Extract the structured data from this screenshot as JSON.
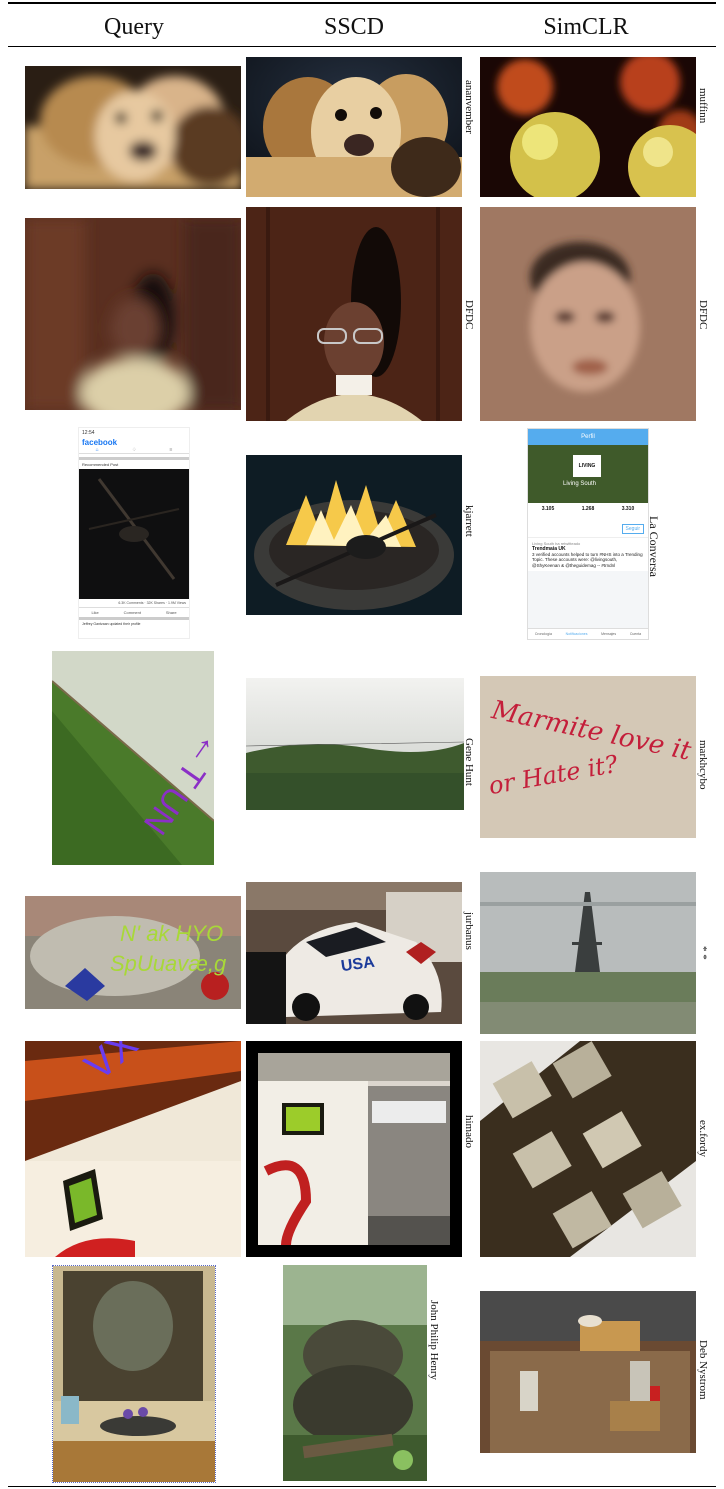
{
  "headers": [
    "Query",
    "SSCD",
    "SimCLR"
  ],
  "rows": [
    {
      "query": "blurred dog",
      "sscd_credit": "ananvember",
      "simclr_credit": "muffinn"
    },
    {
      "query": "blurred person",
      "sscd_credit": "DFDC",
      "simclr_credit": "DFDC"
    },
    {
      "query": "facebook screenshot",
      "sscd_credit": "kjarrett",
      "simclr_credit": "La Conversa"
    },
    {
      "query": "rotated meadow with text",
      "sscd_credit": "Gene Hunt",
      "simclr_credit": "markhcybo"
    },
    {
      "query": "car with overlay text",
      "sscd_credit": "jurbanus",
      "simclr_credit": "* *"
    },
    {
      "query": "train with text",
      "sscd_credit": "himado",
      "simclr_credit": "ex.fordy"
    },
    {
      "query": "window stone art",
      "sscd_credit": "John Philip Henry",
      "simclr_credit": "Deb Nystrom"
    }
  ],
  "fb": {
    "time": "12:54",
    "brand": "facebook",
    "section": "Recommended Post",
    "stats": "6.3K Comments · 32K Shares · 1.9M Views",
    "like": "Like",
    "comment": "Comment",
    "share": "Share",
    "footer": "Jeffrey Gantzaan updated their profile"
  },
  "tw": {
    "title": "Perfil",
    "banner": "LIVING",
    "name": "Living South",
    "tweets_num": "3.105",
    "following_num": "1.268",
    "followers_num": "3.310",
    "follow_btn": "Seguir",
    "tweet_head": "Living South ha retwitteado",
    "tweet_user": "Trendmaia UK",
    "tweet_text": "3 verified accounts helped to turn #NHS into a Trending Topic. These accounts were: @livingsouth, @ShyKeenan & @theguidemag -- #trndnl",
    "tabs": [
      "Cronología",
      "Notificaciones",
      "Mensajes",
      "Cuenta"
    ]
  },
  "query_texts": {
    "rotated": "91 JT ←T UN",
    "car_line1": "N' ak HYO",
    "car_line2": "SpUuavæ,g",
    "train": "VX"
  },
  "marmite": {
    "line1": "Marmite love it",
    "line2": "or Hate it?"
  },
  "usa": "USA"
}
